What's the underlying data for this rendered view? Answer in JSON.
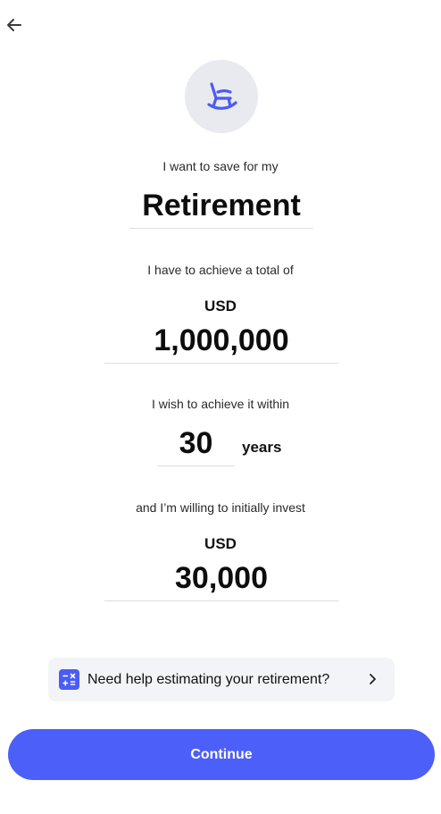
{
  "nav": {
    "back_icon": "arrow-left-icon"
  },
  "goal": {
    "icon": "rocking-chair-icon",
    "intro": "I want to save for my",
    "value": "Retirement"
  },
  "target": {
    "label": "I have to achieve a total of",
    "currency": "USD",
    "value": "1,000,000"
  },
  "timeframe": {
    "label": "I wish to achieve it within",
    "value": "30",
    "unit": "years"
  },
  "initial": {
    "label": "and I’m willing to initially invest",
    "currency": "USD",
    "value": "30,000"
  },
  "help": {
    "icon": "calculator-icon",
    "text": "Need help estimating your retirement?",
    "chevron_icon": "chevron-right-icon"
  },
  "cta": {
    "label": "Continue"
  },
  "colors": {
    "accent": "#4c5ff8",
    "icon_circle_bg": "#e9eaef",
    "help_card_bg": "#f3f4f7"
  }
}
